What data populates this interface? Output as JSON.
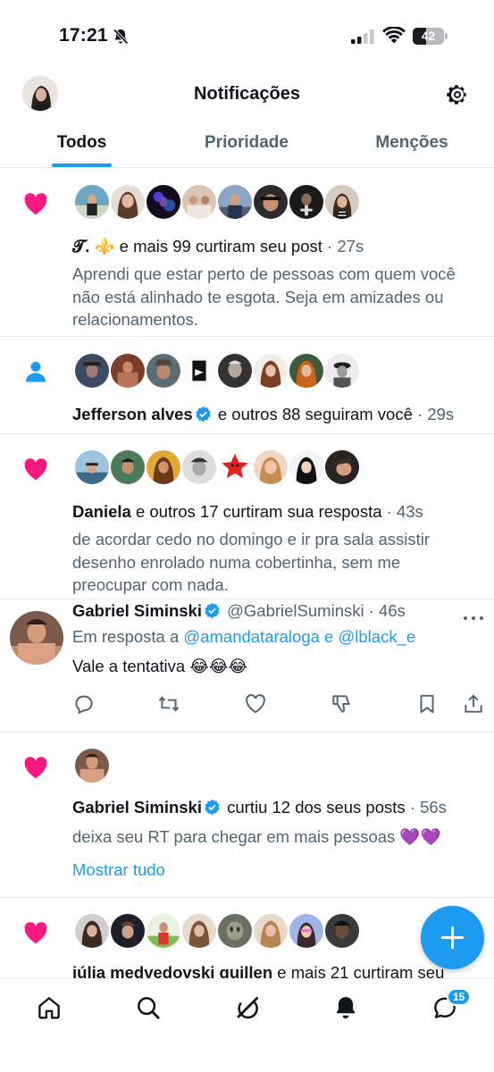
{
  "status_bar": {
    "time": "17:21",
    "battery": "42",
    "battery_level": 0.42
  },
  "header": {
    "title": "Notificações",
    "tabs": [
      {
        "label": "Todos",
        "active": true
      },
      {
        "label": "Prioridade",
        "active": false
      },
      {
        "label": "Menções",
        "active": false
      }
    ]
  },
  "notifications": [
    {
      "type": "like",
      "icon": "heart-icon",
      "actor": "𝓣. ⚜️",
      "action": " e mais 99 curtiram seu post",
      "time": "· 27s",
      "snippet": "Aprendi que estar perto de pessoas com quem você não está alinhado te esgota. Seja em amizades ou relacionamentos."
    },
    {
      "type": "follow",
      "icon": "person-icon",
      "actor": "Jefferson alves",
      "verified": true,
      "action": " e outros 88 seguiram você",
      "time": "· 29s"
    },
    {
      "type": "like",
      "icon": "heart-icon",
      "actor": "Daniela",
      "action": " e outros 17 curtiram sua resposta",
      "time": "· 43s",
      "snippet": "de acordar cedo no domingo e ir pra sala assistir desenho enrolado numa cobertinha, sem me preocupar com nada."
    },
    {
      "type": "reply",
      "author": "Gabriel Siminski",
      "verified": true,
      "handle": "@GabrielSuminski",
      "time": "· 46s",
      "reply_prefix": "Em resposta a ",
      "reply_to_1": "@amandataraloga",
      "reply_and": " e ",
      "reply_to_2": "@lblack_e",
      "text": "Vale a tentativa 😂😂😂"
    },
    {
      "type": "like",
      "icon": "heart-icon",
      "actor": "Gabriel Siminski",
      "verified": true,
      "action": " curtiu 12 dos seus posts",
      "time": "· 56s",
      "snippet": "deixa seu RT para chegar em mais pessoas 💜💜",
      "show_all": "Mostrar tudo"
    },
    {
      "type": "like",
      "icon": "heart-icon",
      "actor": "júlia medvedovski guillen",
      "action": " e mais 21 curtiram seu"
    }
  ],
  "bottom_nav": {
    "items": [
      "home-icon",
      "search-icon",
      "grok-icon",
      "notifications-icon",
      "messages-icon"
    ],
    "messages_badge": "15"
  },
  "colors": {
    "accent": "#1d9bf0",
    "like": "#f91880",
    "text": "#0f1419",
    "secondary": "#536471"
  }
}
